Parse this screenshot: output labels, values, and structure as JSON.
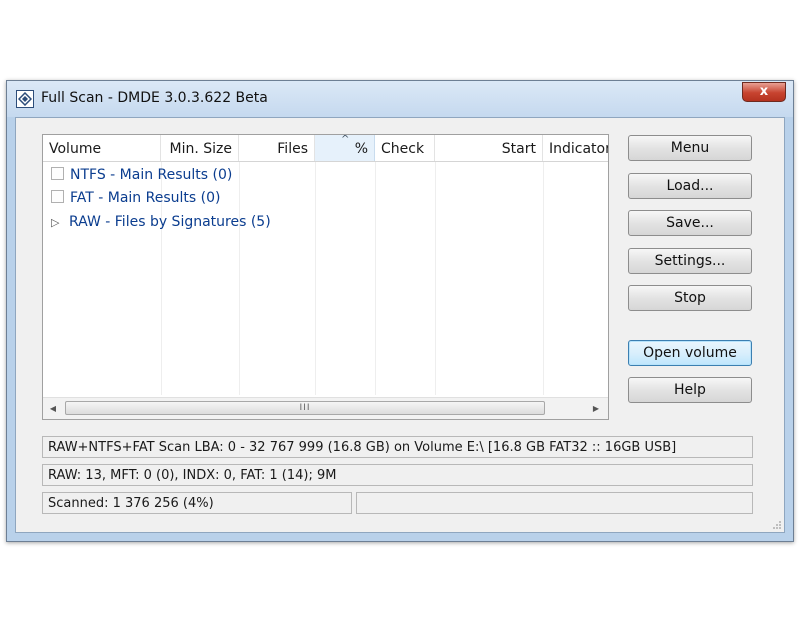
{
  "window": {
    "title": "Full Scan - DMDE 3.0.3.622 Beta",
    "close_glyph": "x",
    "icon": "dmde-app-icon"
  },
  "listview": {
    "columns": [
      {
        "label": "Volume",
        "align": "left"
      },
      {
        "label": "Min. Size",
        "align": "right"
      },
      {
        "label": "Files",
        "align": "right"
      },
      {
        "label": "%",
        "align": "right"
      },
      {
        "label": "Check",
        "align": "left"
      },
      {
        "label": "Start",
        "align": "right"
      },
      {
        "label": "Indicator",
        "align": "left"
      }
    ],
    "sort_indicator": "^",
    "rows": [
      {
        "label": "NTFS - Main Results (0)",
        "kind": "checkbox"
      },
      {
        "label": "FAT - Main Results (0)",
        "kind": "checkbox"
      },
      {
        "label": "RAW - Files by Signatures (5)",
        "kind": "expander"
      }
    ],
    "expander_glyph": "▷",
    "scroll_thumb_grip": "III",
    "scroll_left": "◀",
    "scroll_right": "▶"
  },
  "buttons": {
    "menu": "Menu",
    "load": "Load...",
    "save": "Save...",
    "settings": "Settings...",
    "stop": "Stop",
    "open_volume": "Open volume",
    "help": "Help"
  },
  "status": {
    "line1": "RAW+NTFS+FAT Scan LBA: 0 - 32 767 999 (16.8 GB) on Volume E:\\ [16.8 GB FAT32 :: 16GB USB]",
    "line2": "RAW: 13, MFT: 0 (0), INDX: 0, FAT: 1 (14); 9M",
    "line3": "Scanned: 1 376 256 (4%)",
    "line3_right": ""
  },
  "colors": {
    "window_frame": "#b9d1ea",
    "client_bg": "#f0f0f0",
    "row_text": "#0b3d8f",
    "close_button": "#c7432f"
  }
}
